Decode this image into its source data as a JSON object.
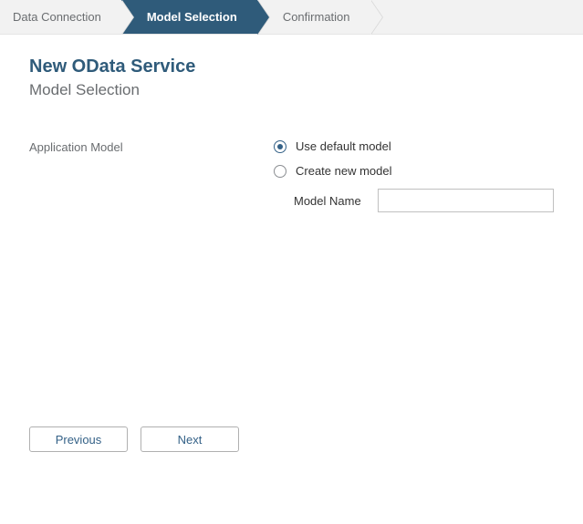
{
  "wizard": {
    "steps": [
      {
        "label": "Data Connection",
        "active": false
      },
      {
        "label": "Model Selection",
        "active": true
      },
      {
        "label": "Confirmation",
        "active": false
      }
    ]
  },
  "header": {
    "title": "New OData Service",
    "subtitle": "Model Selection"
  },
  "form": {
    "application_model_label": "Application Model",
    "options": {
      "use_default": "Use default model",
      "create_new": "Create new model"
    },
    "selected_option": "use_default",
    "model_name_label": "Model Name",
    "model_name_value": ""
  },
  "footer": {
    "previous": "Previous",
    "next": "Next"
  }
}
